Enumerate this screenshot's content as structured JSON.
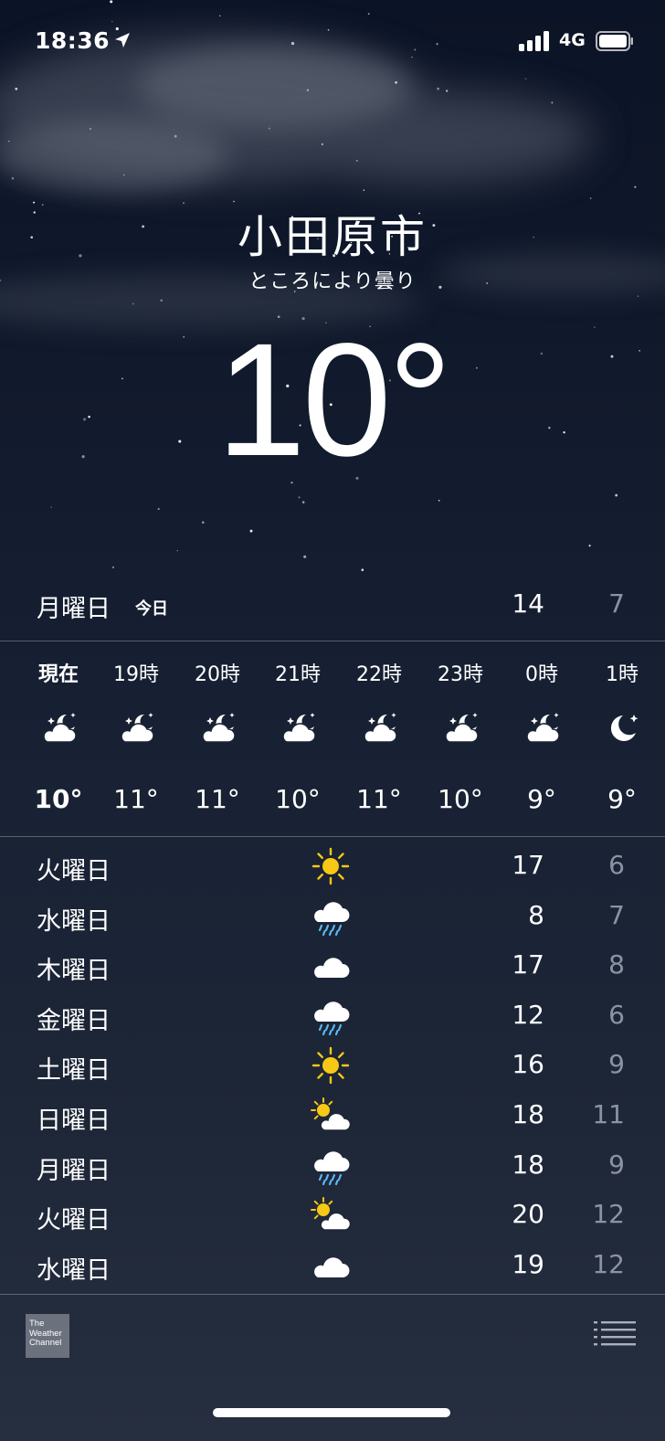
{
  "status_bar": {
    "time": "18:36",
    "network": "4G"
  },
  "location": {
    "city": "小田原市",
    "condition": "ところにより曇り",
    "temperature": "10°"
  },
  "today": {
    "day": "月曜日",
    "tag": "今日",
    "high": "14",
    "low": "7"
  },
  "hourly": [
    {
      "label": "現在",
      "icon": "cloud-moon-icon",
      "temp": "10°"
    },
    {
      "label": "19時",
      "icon": "cloud-moon-icon",
      "temp": "11°"
    },
    {
      "label": "20時",
      "icon": "cloud-moon-icon",
      "temp": "11°"
    },
    {
      "label": "21時",
      "icon": "cloud-moon-icon",
      "temp": "10°"
    },
    {
      "label": "22時",
      "icon": "cloud-moon-icon",
      "temp": "11°"
    },
    {
      "label": "23時",
      "icon": "cloud-moon-icon",
      "temp": "10°"
    },
    {
      "label": "0時",
      "icon": "cloud-moon-icon",
      "temp": "9°"
    },
    {
      "label": "1時",
      "icon": "moon-icon",
      "temp": "9°"
    }
  ],
  "daily": [
    {
      "day": "火曜日",
      "icon": "sun-icon",
      "high": "17",
      "low": "6"
    },
    {
      "day": "水曜日",
      "icon": "rain-icon",
      "high": "8",
      "low": "7"
    },
    {
      "day": "木曜日",
      "icon": "cloud-icon",
      "high": "17",
      "low": "8"
    },
    {
      "day": "金曜日",
      "icon": "rain-icon",
      "high": "12",
      "low": "6"
    },
    {
      "day": "土曜日",
      "icon": "sun-icon",
      "high": "16",
      "low": "9"
    },
    {
      "day": "日曜日",
      "icon": "partly-cloudy-icon",
      "high": "18",
      "low": "11"
    },
    {
      "day": "月曜日",
      "icon": "rain-icon",
      "high": "18",
      "low": "9"
    },
    {
      "day": "火曜日",
      "icon": "partly-cloudy-icon",
      "high": "20",
      "low": "12"
    },
    {
      "day": "水曜日",
      "icon": "cloud-icon",
      "high": "19",
      "low": "12"
    }
  ],
  "footer": {
    "logo_text": "The Weather Channel"
  },
  "colors": {
    "sun": "#f7c815",
    "rain": "#5ab8f5",
    "low_temp": "#8b93a3"
  }
}
